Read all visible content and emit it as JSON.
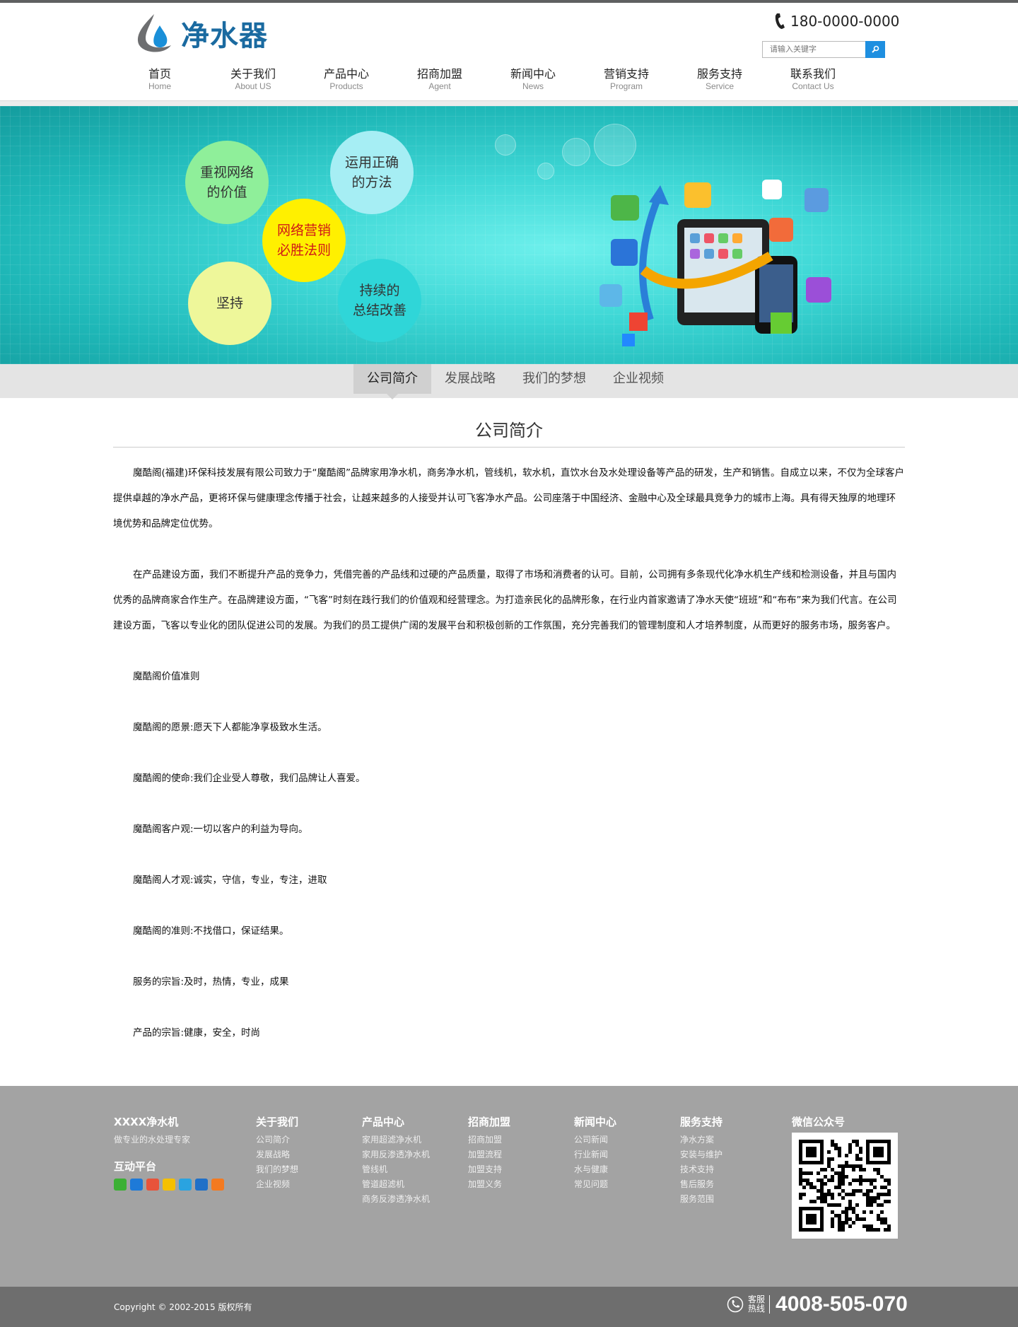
{
  "header": {
    "logo_text": "净水器",
    "phone": "180-0000-0000",
    "search_placeholder": "请输入关键字"
  },
  "nav": [
    {
      "cn": "首页",
      "en": "Home"
    },
    {
      "cn": "关于我们",
      "en": "About US"
    },
    {
      "cn": "产品中心",
      "en": "Products"
    },
    {
      "cn": "招商加盟",
      "en": "Agent"
    },
    {
      "cn": "新闻中心",
      "en": "News"
    },
    {
      "cn": "营销支持",
      "en": "Program"
    },
    {
      "cn": "服务支持",
      "en": "Service"
    },
    {
      "cn": "联系我们",
      "en": "Contact Us"
    }
  ],
  "banner": {
    "circle1": "重视网络\n的价值",
    "circle2": "运用正确\n的方法",
    "circle3": "网络营销\n必胜法则",
    "circle4": "坚持",
    "circle5": "持续的\n总结改善",
    "colors": {
      "green": "#8fef9a",
      "cyan": "#a6eef4",
      "yellow": "#fff000",
      "lime": "#eef79a",
      "teal": "#2fd6d8"
    }
  },
  "subnav": [
    "公司简介",
    "发展战略",
    "我们的梦想",
    "企业视频"
  ],
  "content": {
    "title": "公司简介",
    "p1": "魔酷阁(福建)环保科技发展有限公司致力于“魔酷阁”品牌家用净水机，商务净水机，管线机，软水机，直饮水台及水处理设备等产品的研发，生产和销售。自成立以来，不仅为全球客户提供卓越的净水产品，更将环保与健康理念传播于社会，让越来越多的人接受并认可飞客净水产品。公司座落于中国经济、金融中心及全球最具竞争力的城市上海。具有得天独厚的地理环境优势和品牌定位优势。",
    "p2": "在产品建设方面，我们不断提升产品的竞争力，凭借完善的产品线和过硬的产品质量，取得了市场和消费者的认可。目前，公司拥有多条现代化净水机生产线和检测设备，并且与国内优秀的品牌商家合作生产。在品牌建设方面，“飞客”时刻在践行我们的价值观和经营理念。为打造亲民化的品牌形象，在行业内首家邀请了净水天使“班班”和“布布”来为我们代言。在公司建设方面，飞客以专业化的团队促进公司的发展。为我们的员工提供广阔的发展平台和积极创新的工作氛围，充分完善我们的管理制度和人才培养制度，从而更好的服务市场，服务客户。",
    "lines": [
      "魔酷阁价值准则",
      "魔酷阁的愿景:愿天下人都能净享极致水生活。",
      "魔酷阁的使命:我们企业受人尊敬，我们品牌让人喜爱。",
      "魔酷阁客户观:一切以客户的利益为导向。",
      "魔酷阁人才观:诚实，守信，专业，专注，进取",
      "魔酷阁的准则:不找借口，保证结果。",
      "服务的宗旨:及时，热情，专业，成果",
      "产品的宗旨:健康，安全，时尚"
    ]
  },
  "footer": {
    "brand": {
      "title": "XXXX净水机",
      "slogan": "做专业的水处理专家",
      "social_title": "互动平台"
    },
    "cols": [
      {
        "title": "关于我们",
        "links": [
          "公司简介",
          "发展战略",
          "我们的梦想",
          "企业视频"
        ]
      },
      {
        "title": "产品中心",
        "links": [
          "家用超滤净水机",
          "家用反渗透净水机",
          "管线机",
          "管道超滤机",
          "商务反渗透净水机"
        ]
      },
      {
        "title": "招商加盟",
        "links": [
          "招商加盟",
          "加盟流程",
          "加盟支持",
          "加盟义务"
        ]
      },
      {
        "title": "新闻中心",
        "links": [
          "公司新闻",
          "行业新闻",
          "水与健康",
          "常见问题"
        ]
      },
      {
        "title": "服务支持",
        "links": [
          "净水方案",
          "安装与维护",
          "技术支持",
          "售后服务",
          "服务范围"
        ]
      }
    ],
    "wechat_title": "微信公众号",
    "copyright": "Copyright © 2002-2015 版权所有",
    "hotline_label": "客服\n热线",
    "hotline": "4008-505-070"
  }
}
